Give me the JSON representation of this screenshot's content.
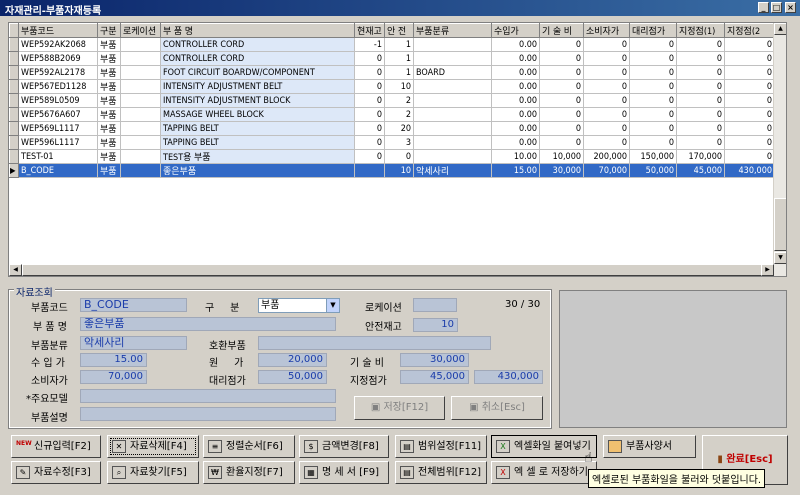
{
  "window": {
    "title": "자재관리-부품자재등록"
  },
  "grid": {
    "columns": [
      "부품코드",
      "구분",
      "로케이션",
      "부 품 명",
      "현재고",
      "안 전",
      "부품분류",
      "수입가",
      "기 술 비",
      "소비자가",
      "대리점가",
      "지정점(1)",
      "지정점(2"
    ],
    "rows": [
      [
        "WEP592AK2068",
        "부품",
        "",
        "CONTROLLER CORD",
        "-1",
        "1",
        "",
        "0.00",
        "0",
        "0",
        "0",
        "0",
        "0"
      ],
      [
        "WEP588B2069",
        "부품",
        "",
        "CONTROLLER CORD",
        "0",
        "1",
        "",
        "0.00",
        "0",
        "0",
        "0",
        "0",
        "0"
      ],
      [
        "WEP592AL2178",
        "부품",
        "",
        "FOOT CIRCUIT BOARDW/COMPONENT",
        "0",
        "1",
        "BOARD",
        "0.00",
        "0",
        "0",
        "0",
        "0",
        "0"
      ],
      [
        "WEP567ED1128",
        "부품",
        "",
        "INTENSITY ADJUSTMENT BELT",
        "0",
        "10",
        "",
        "0.00",
        "0",
        "0",
        "0",
        "0",
        "0"
      ],
      [
        "WEP589L0509",
        "부품",
        "",
        "INTENSITY ADJUSTMENT BLOCK",
        "0",
        "2",
        "",
        "0.00",
        "0",
        "0",
        "0",
        "0",
        "0"
      ],
      [
        "WEP5676A607",
        "부품",
        "",
        "MASSAGE WHEEL BLOCK",
        "0",
        "2",
        "",
        "0.00",
        "0",
        "0",
        "0",
        "0",
        "0"
      ],
      [
        "WEP569L1117",
        "부품",
        "",
        "TAPPING BELT",
        "0",
        "20",
        "",
        "0.00",
        "0",
        "0",
        "0",
        "0",
        "0"
      ],
      [
        "WEP596L1117",
        "부품",
        "",
        "TAPPING BELT",
        "0",
        "3",
        "",
        "0.00",
        "0",
        "0",
        "0",
        "0",
        "0"
      ],
      [
        "TEST-01",
        "부품",
        "",
        "TEST용 부품",
        "0",
        "0",
        "",
        "10.00",
        "10,000",
        "200,000",
        "150,000",
        "170,000",
        "0"
      ],
      [
        "B_CODE",
        "부품",
        "",
        "좋은부품",
        "",
        "10",
        "악세사리",
        "15.00",
        "30,000",
        "70,000",
        "50,000",
        "45,000",
        "430,000"
      ]
    ],
    "selected_row": 9
  },
  "form": {
    "legend": "자료조회",
    "code_label": "부품코드",
    "code_value": "B_CODE",
    "type_label": "구     분",
    "type_value": "부품",
    "location_label": "로케이션",
    "location_value": "",
    "counter": "30 / 30",
    "name_label": "부 품 명",
    "name_value": "좋은부품",
    "safety_label": "안전재고",
    "safety_value": "10",
    "category_label": "부품분류",
    "category_value": "악세사리",
    "compat_label": "호환부품",
    "compat_value": "",
    "import_label": "수 입 가",
    "import_value": "15.00",
    "cost_label": "원     가",
    "cost_value": "20,000",
    "tech_label": "기 술 비",
    "tech_value": "30,000",
    "consumer_label": "소비자가",
    "consumer_value": "70,000",
    "agency_label": "대리점가",
    "agency_value": "50,000",
    "designated_label": "지정점가",
    "designated_value1": "45,000",
    "designated_value2": "430,000",
    "model_label": "*주요모델",
    "model_value": "",
    "desc_label": "부품설명",
    "desc_value": "",
    "save_label": "저장[F12]",
    "cancel_label": "취소[Esc]"
  },
  "actions": {
    "new": "신규입력[F2]",
    "delete": "자료삭제[F4]",
    "sort": "정렬순서[F6]",
    "price": "금액변경[F8]",
    "range": "범위설정[F11]",
    "excel_import": "엑셀화일 붙여넣기",
    "spec": "부품사양서",
    "edit": "자료수정[F3]",
    "find": "자료찾기[F5]",
    "exchange": "환율지정[F7]",
    "detail": "명 세 서 [F9]",
    "all_range": "전체범위[F12]",
    "excel_save": "엑 셀 로 저장하기",
    "done": "완료[Esc]",
    "new_badge": "NEW"
  },
  "tooltip": "엑셀로된 부품화일을 불러와 덧붙입니다.",
  "colors": {
    "accent": "#3169c6",
    "field": "#b9c4d6",
    "field_text": "#1a3caa",
    "done_text": "#c00000"
  }
}
